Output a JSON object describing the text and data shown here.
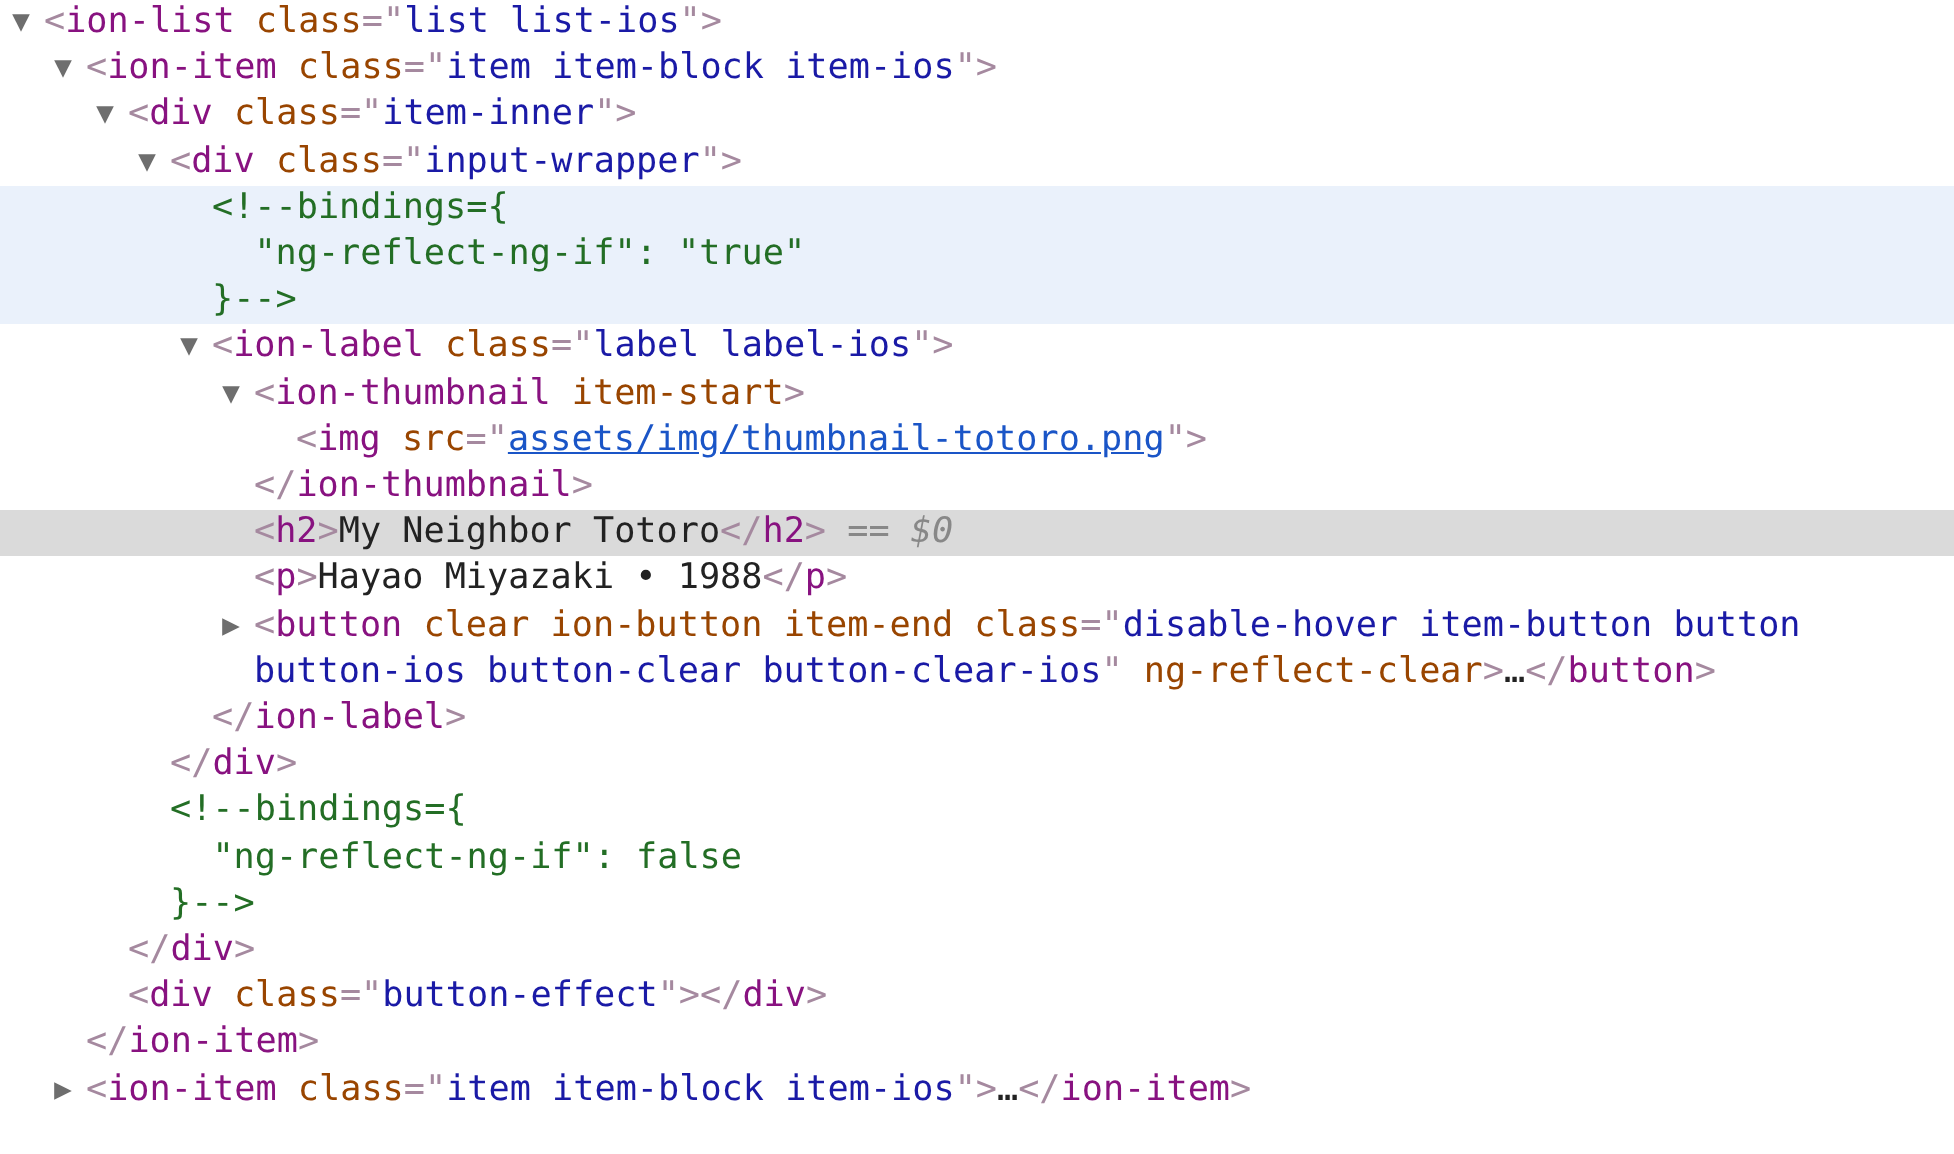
{
  "tree": {
    "kind": "element",
    "expanded": true,
    "selected": false,
    "hovered": false,
    "open": [
      {
        "kind": "punct",
        "text": "<"
      },
      {
        "kind": "tag",
        "text": "ion-list"
      },
      {
        "kind": "attr",
        "text": " class"
      },
      {
        "kind": "punct",
        "text": "=\""
      },
      {
        "kind": "value",
        "text": "list list-ios"
      },
      {
        "kind": "punct",
        "text": "\">"
      }
    ],
    "children": [
      {
        "kind": "element",
        "expanded": true,
        "selected": false,
        "hovered": false,
        "open": [
          {
            "kind": "punct",
            "text": "<"
          },
          {
            "kind": "tag",
            "text": "ion-item"
          },
          {
            "kind": "attr",
            "text": " class"
          },
          {
            "kind": "punct",
            "text": "=\""
          },
          {
            "kind": "value",
            "text": "item item-block item-ios"
          },
          {
            "kind": "punct",
            "text": "\">"
          }
        ],
        "children": [
          {
            "kind": "element",
            "expanded": true,
            "selected": false,
            "hovered": false,
            "open": [
              {
                "kind": "punct",
                "text": "<"
              },
              {
                "kind": "tag",
                "text": "div"
              },
              {
                "kind": "attr",
                "text": " class"
              },
              {
                "kind": "punct",
                "text": "=\""
              },
              {
                "kind": "value",
                "text": "item-inner"
              },
              {
                "kind": "punct",
                "text": "\">"
              }
            ],
            "children": [
              {
                "kind": "element",
                "expanded": true,
                "selected": false,
                "hovered": false,
                "open": [
                  {
                    "kind": "punct",
                    "text": "<"
                  },
                  {
                    "kind": "tag",
                    "text": "div"
                  },
                  {
                    "kind": "attr",
                    "text": " class"
                  },
                  {
                    "kind": "punct",
                    "text": "=\""
                  },
                  {
                    "kind": "value",
                    "text": "input-wrapper"
                  },
                  {
                    "kind": "punct",
                    "text": "\">"
                  }
                ],
                "children": [
                  {
                    "kind": "comment",
                    "selected": false,
                    "hovered": true,
                    "lines": [
                      "<!--bindings={",
                      "  \"ng-reflect-ng-if\": \"true\"",
                      "}-->"
                    ]
                  },
                  {
                    "kind": "element",
                    "expanded": true,
                    "selected": false,
                    "hovered": false,
                    "open": [
                      {
                        "kind": "punct",
                        "text": "<"
                      },
                      {
                        "kind": "tag",
                        "text": "ion-label"
                      },
                      {
                        "kind": "attr",
                        "text": " class"
                      },
                      {
                        "kind": "punct",
                        "text": "=\""
                      },
                      {
                        "kind": "value",
                        "text": "label label-ios"
                      },
                      {
                        "kind": "punct",
                        "text": "\">"
                      }
                    ],
                    "children": [
                      {
                        "kind": "element",
                        "expanded": true,
                        "selected": false,
                        "hovered": false,
                        "open": [
                          {
                            "kind": "punct",
                            "text": "<"
                          },
                          {
                            "kind": "tag",
                            "text": "ion-thumbnail"
                          },
                          {
                            "kind": "attr",
                            "text": " item-start"
                          },
                          {
                            "kind": "punct",
                            "text": ">"
                          }
                        ],
                        "children": [
                          {
                            "kind": "leaf",
                            "selected": false,
                            "hovered": false,
                            "tokens": [
                              {
                                "kind": "punct",
                                "text": "<"
                              },
                              {
                                "kind": "tag",
                                "text": "img"
                              },
                              {
                                "kind": "attr",
                                "text": " src"
                              },
                              {
                                "kind": "punct",
                                "text": "=\""
                              },
                              {
                                "kind": "link",
                                "text": "assets/img/thumbnail-totoro.png"
                              },
                              {
                                "kind": "punct",
                                "text": "\">"
                              }
                            ]
                          }
                        ],
                        "close": [
                          {
                            "kind": "punct",
                            "text": "</"
                          },
                          {
                            "kind": "tag",
                            "text": "ion-thumbnail"
                          },
                          {
                            "kind": "punct",
                            "text": ">"
                          }
                        ]
                      },
                      {
                        "kind": "leaf",
                        "selected": true,
                        "hovered": false,
                        "tokens": [
                          {
                            "kind": "punct",
                            "text": "<"
                          },
                          {
                            "kind": "tag",
                            "text": "h2"
                          },
                          {
                            "kind": "punct",
                            "text": ">"
                          },
                          {
                            "kind": "text",
                            "text": "My Neighbor Totoro"
                          },
                          {
                            "kind": "punct",
                            "text": "</"
                          },
                          {
                            "kind": "tag",
                            "text": "h2"
                          },
                          {
                            "kind": "punct",
                            "text": ">"
                          },
                          {
                            "kind": "hint",
                            "text": " == "
                          },
                          {
                            "kind": "var",
                            "text": "$0"
                          }
                        ]
                      },
                      {
                        "kind": "leaf",
                        "selected": false,
                        "hovered": false,
                        "tokens": [
                          {
                            "kind": "punct",
                            "text": "<"
                          },
                          {
                            "kind": "tag",
                            "text": "p"
                          },
                          {
                            "kind": "punct",
                            "text": ">"
                          },
                          {
                            "kind": "text",
                            "text": "Hayao Miyazaki • 1988"
                          },
                          {
                            "kind": "punct",
                            "text": "</"
                          },
                          {
                            "kind": "tag",
                            "text": "p"
                          },
                          {
                            "kind": "punct",
                            "text": ">"
                          }
                        ]
                      },
                      {
                        "kind": "element",
                        "expanded": false,
                        "selected": false,
                        "hovered": false,
                        "open": [
                          {
                            "kind": "punct",
                            "text": "<"
                          },
                          {
                            "kind": "tag",
                            "text": "button"
                          },
                          {
                            "kind": "attr",
                            "text": " clear ion-button item-end class"
                          },
                          {
                            "kind": "punct",
                            "text": "=\""
                          },
                          {
                            "kind": "value",
                            "text": "disable-hover item-button button button-ios button-clear button-clear-ios"
                          },
                          {
                            "kind": "punct",
                            "text": "\""
                          },
                          {
                            "kind": "attr",
                            "text": " ng-reflect-clear"
                          },
                          {
                            "kind": "punct",
                            "text": ">"
                          },
                          {
                            "kind": "text",
                            "text": "…"
                          },
                          {
                            "kind": "punct",
                            "text": "</"
                          },
                          {
                            "kind": "tag",
                            "text": "button"
                          },
                          {
                            "kind": "punct",
                            "text": ">"
                          }
                        ]
                      }
                    ],
                    "close": [
                      {
                        "kind": "punct",
                        "text": "</"
                      },
                      {
                        "kind": "tag",
                        "text": "ion-label"
                      },
                      {
                        "kind": "punct",
                        "text": ">"
                      }
                    ]
                  }
                ],
                "close": [
                  {
                    "kind": "punct",
                    "text": "</"
                  },
                  {
                    "kind": "tag",
                    "text": "div"
                  },
                  {
                    "kind": "punct",
                    "text": ">"
                  }
                ]
              },
              {
                "kind": "comment",
                "selected": false,
                "hovered": false,
                "lines": [
                  "<!--bindings={",
                  "  \"ng-reflect-ng-if\": false",
                  "}-->"
                ]
              }
            ],
            "close": [
              {
                "kind": "punct",
                "text": "</"
              },
              {
                "kind": "tag",
                "text": "div"
              },
              {
                "kind": "punct",
                "text": ">"
              }
            ]
          },
          {
            "kind": "leaf",
            "selected": false,
            "hovered": false,
            "tokens": [
              {
                "kind": "punct",
                "text": "<"
              },
              {
                "kind": "tag",
                "text": "div"
              },
              {
                "kind": "attr",
                "text": " class"
              },
              {
                "kind": "punct",
                "text": "=\""
              },
              {
                "kind": "value",
                "text": "button-effect"
              },
              {
                "kind": "punct",
                "text": "\"></"
              },
              {
                "kind": "tag",
                "text": "div"
              },
              {
                "kind": "punct",
                "text": ">"
              }
            ]
          }
        ],
        "close": [
          {
            "kind": "punct",
            "text": "</"
          },
          {
            "kind": "tag",
            "text": "ion-item"
          },
          {
            "kind": "punct",
            "text": ">"
          }
        ]
      },
      {
        "kind": "element",
        "expanded": false,
        "selected": false,
        "hovered": false,
        "open": [
          {
            "kind": "punct",
            "text": "<"
          },
          {
            "kind": "tag",
            "text": "ion-item"
          },
          {
            "kind": "attr",
            "text": " class"
          },
          {
            "kind": "punct",
            "text": "=\""
          },
          {
            "kind": "value",
            "text": "item item-block item-ios"
          },
          {
            "kind": "punct",
            "text": "\">"
          },
          {
            "kind": "text",
            "text": "…"
          },
          {
            "kind": "punct",
            "text": "</"
          },
          {
            "kind": "tag",
            "text": "ion-item"
          },
          {
            "kind": "punct",
            "text": ">"
          }
        ]
      }
    ]
  }
}
